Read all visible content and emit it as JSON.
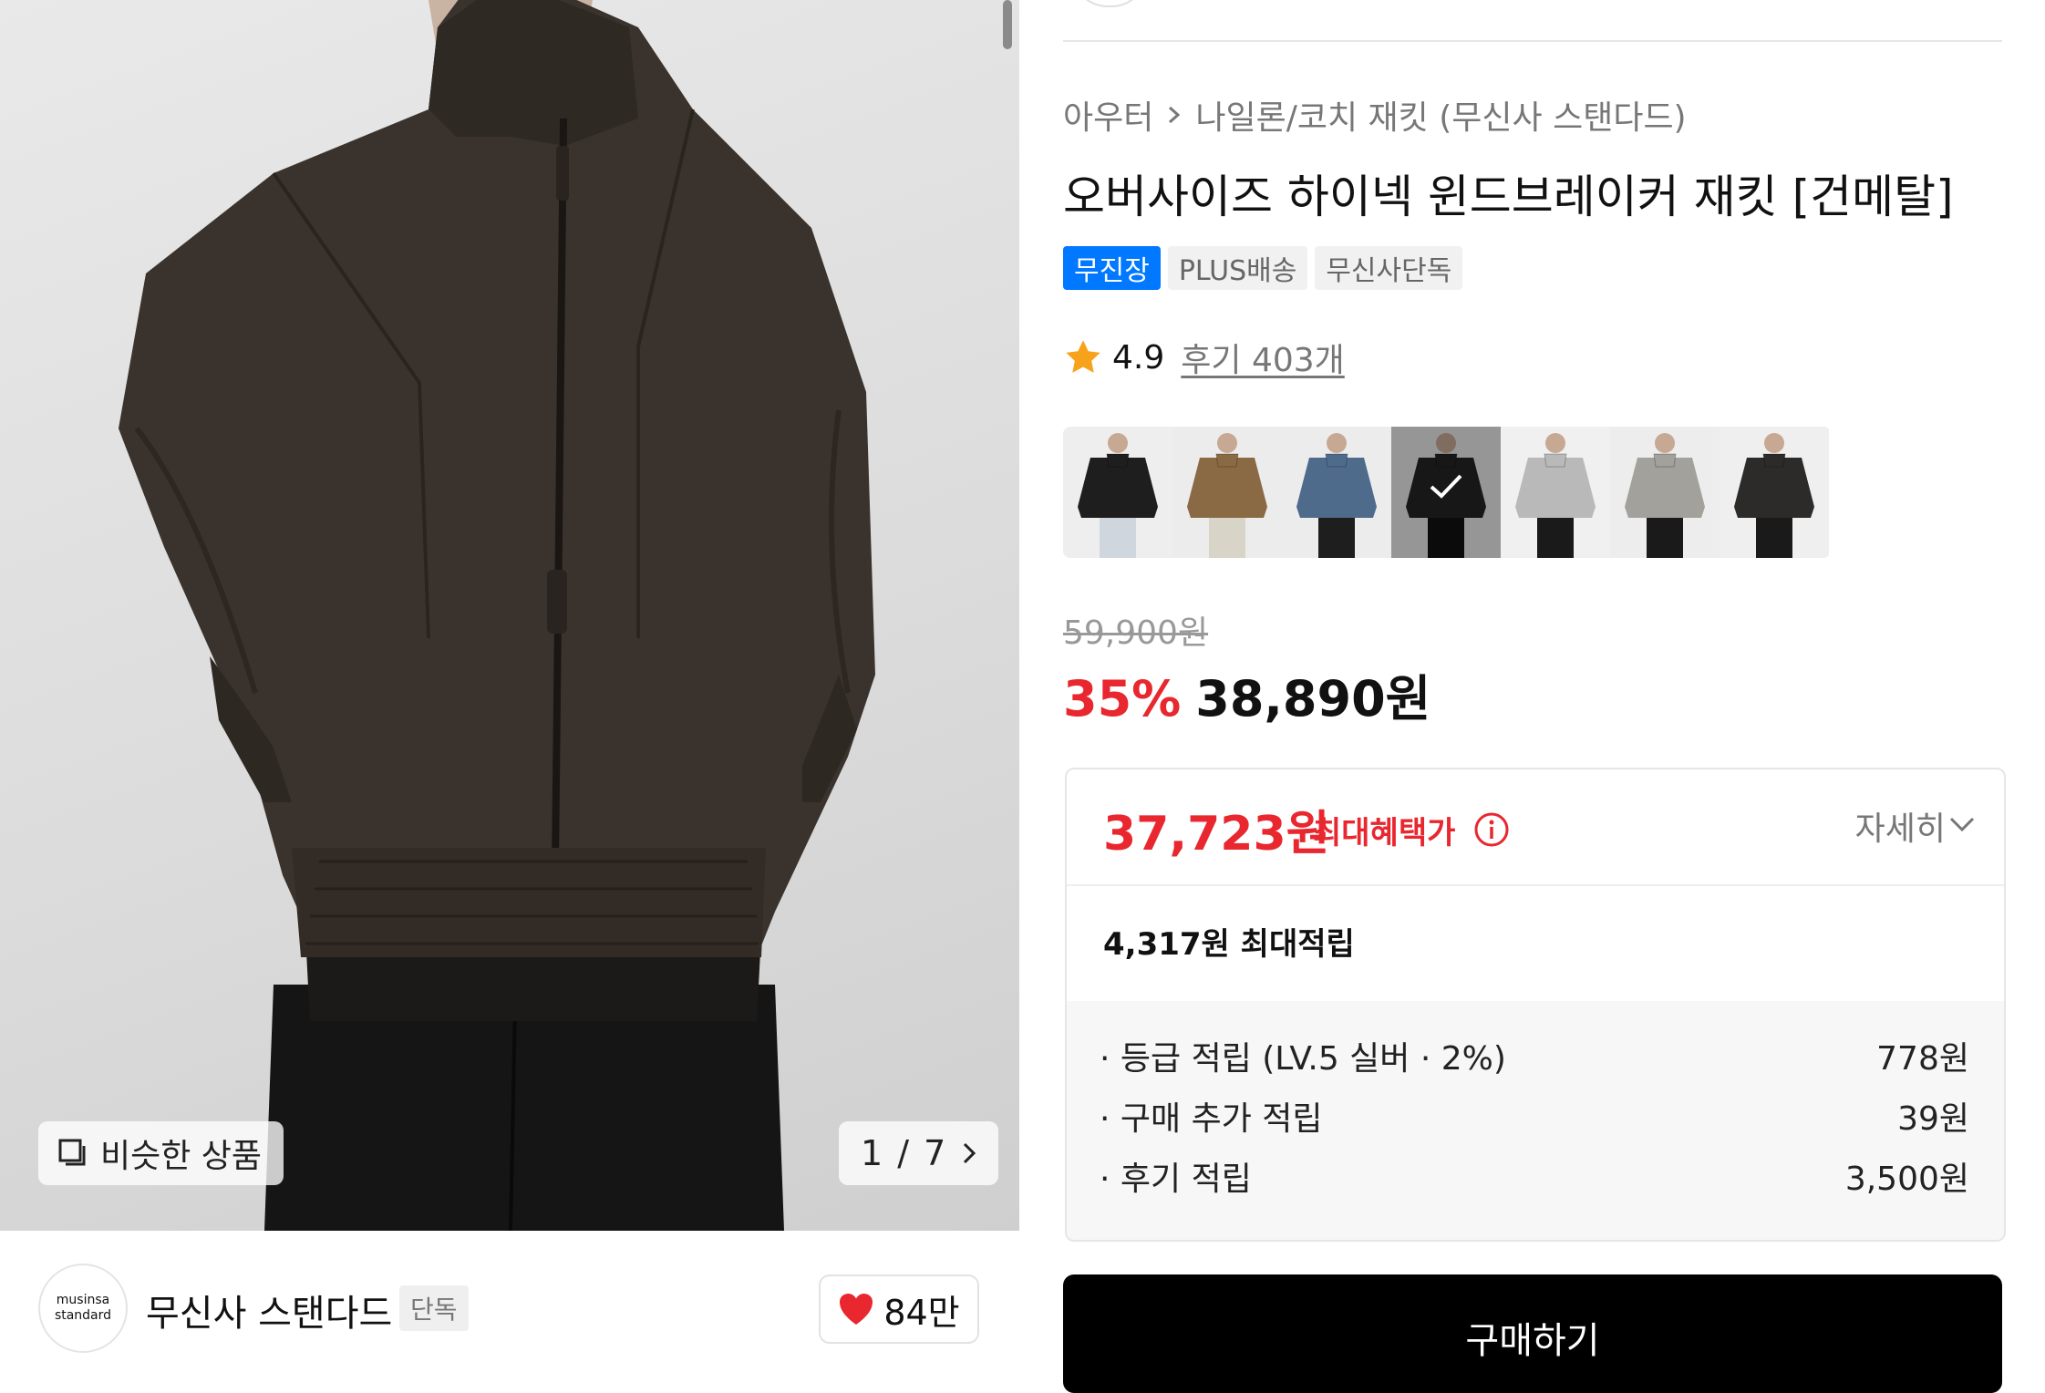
{
  "image_panel": {
    "similar_button_label": "비슷한 상품",
    "counter": "1 / 7"
  },
  "brand": {
    "logo_line1": "musinsa",
    "logo_line2": "standard",
    "name": "무신사 스탠다드",
    "badge": "단독",
    "like_count": "84만"
  },
  "breadcrumb": {
    "level1": "아우터",
    "level2": "나일론/코치 재킷 (무신사 스탠다드)"
  },
  "product": {
    "title": "오버사이즈 하이넥 윈드브레이커 재킷 [건메탈]",
    "tags": [
      "무진장",
      "PLUS배송",
      "무신사단독"
    ],
    "rating": "4.9",
    "review_link": "후기 403개",
    "original_price": "59,900원",
    "discount_rate": "35%",
    "sale_price": "38,890원"
  },
  "swatches": [
    {
      "name": "black-wide",
      "jacket": "#1e1e1e",
      "bg": "#eeeeee",
      "pants": "#cfd6de"
    },
    {
      "name": "camel",
      "jacket": "#8a6a44",
      "bg": "#ececec",
      "pants": "#d9d4c8"
    },
    {
      "name": "blue",
      "jacket": "#4f6b8c",
      "bg": "#ececec",
      "pants": "#1e1e1e"
    },
    {
      "name": "gunmetal",
      "jacket": "#242424",
      "bg": "#e6e6e6",
      "pants": "#111111",
      "selected": true
    },
    {
      "name": "light-gray-hood",
      "jacket": "#b9b9b9",
      "bg": "#f0f0f0",
      "pants": "#1a1a1a"
    },
    {
      "name": "gray",
      "jacket": "#a3a19c",
      "bg": "#ededed",
      "pants": "#1a1a1a"
    },
    {
      "name": "charcoal",
      "jacket": "#2c2b29",
      "bg": "#efefef",
      "pants": "#1a1a1a"
    }
  ],
  "benefit": {
    "max_price": "37,723원",
    "max_label": "최대혜택가",
    "detail_label": "자세히",
    "points_total": "4,317원 최대적립",
    "rows": [
      {
        "label": "· 등급 적립 (LV.5 실버 · 2%)",
        "value": "778원"
      },
      {
        "label": "· 구매 추가 적립",
        "value": "39원"
      },
      {
        "label": "· 후기 적립",
        "value": "3,500원"
      }
    ]
  },
  "buy_button_label": "구매하기",
  "colors": {
    "accent_blue": "#0078ff",
    "sale_red": "#e8272f",
    "star": "#f7a21b",
    "heart": "#e8272f"
  },
  "icons": {
    "similar": "copy-icon",
    "counter": "chevron-right-icon",
    "like": "heart-icon",
    "rating": "star-icon",
    "breadcrumb": "chevron-right-icon",
    "info": "info-icon",
    "detail": "chevron-down-icon",
    "swatch_selected": "check-icon"
  }
}
